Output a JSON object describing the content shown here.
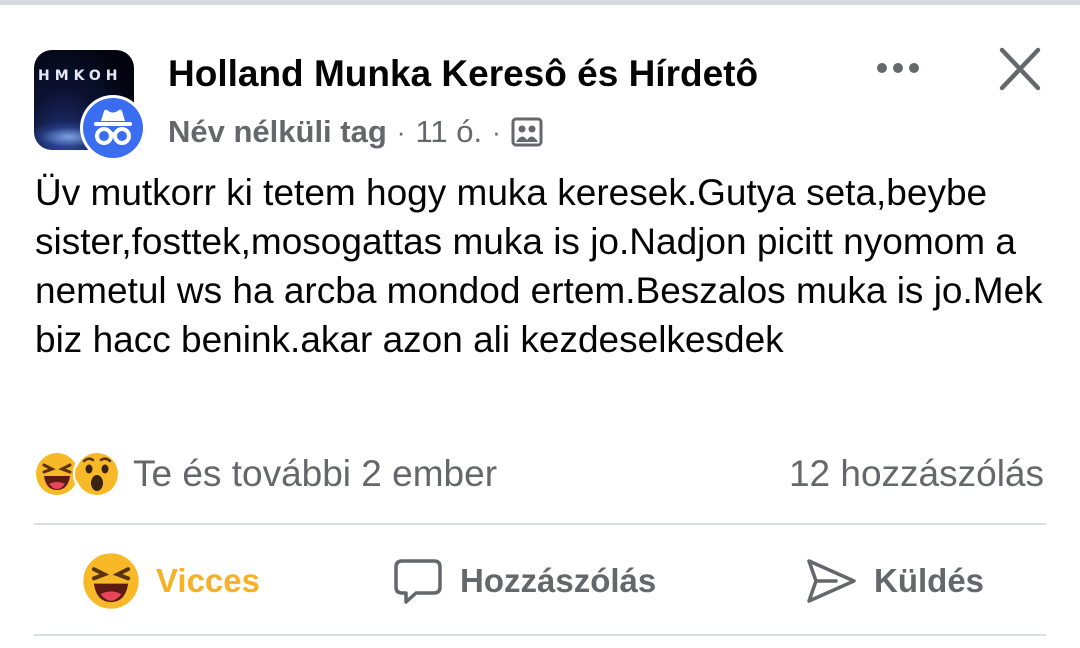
{
  "header": {
    "group_name": "Holland Munka Keresô és Hírdetô",
    "group_logo_text": "HMKOH",
    "author": "Név nélküli tag",
    "separator": "·",
    "time": "11 ó.",
    "audience_icon": "group-privacy-icon",
    "more_icon": "more-icon",
    "close_icon": "close-icon"
  },
  "post": {
    "text": "Üv mutkorr ki tetem hogy muka keresek.Gutya seta,beybe sister,fosttek,mosogattas muka is jo.Nadjon picitt nyomom a nemetul ws ha arcba mondod ertem.Beszalos muka is jo.Mek biz hacc benink.akar azon ali kezdeselkesdek"
  },
  "reactions": {
    "icons": [
      "haha-icon",
      "wow-icon"
    ],
    "label": "Te és további 2 ember",
    "comment_count": "12 hozzászólás"
  },
  "actions": {
    "reaction_label": "Vicces",
    "reaction_color": "#f7b125",
    "comment_label": "Hozzászólás",
    "send_label": "Küldés"
  },
  "colors": {
    "text_primary": "#050505",
    "text_secondary": "#65676b",
    "anonymous_avatar": "#3b6df0"
  }
}
